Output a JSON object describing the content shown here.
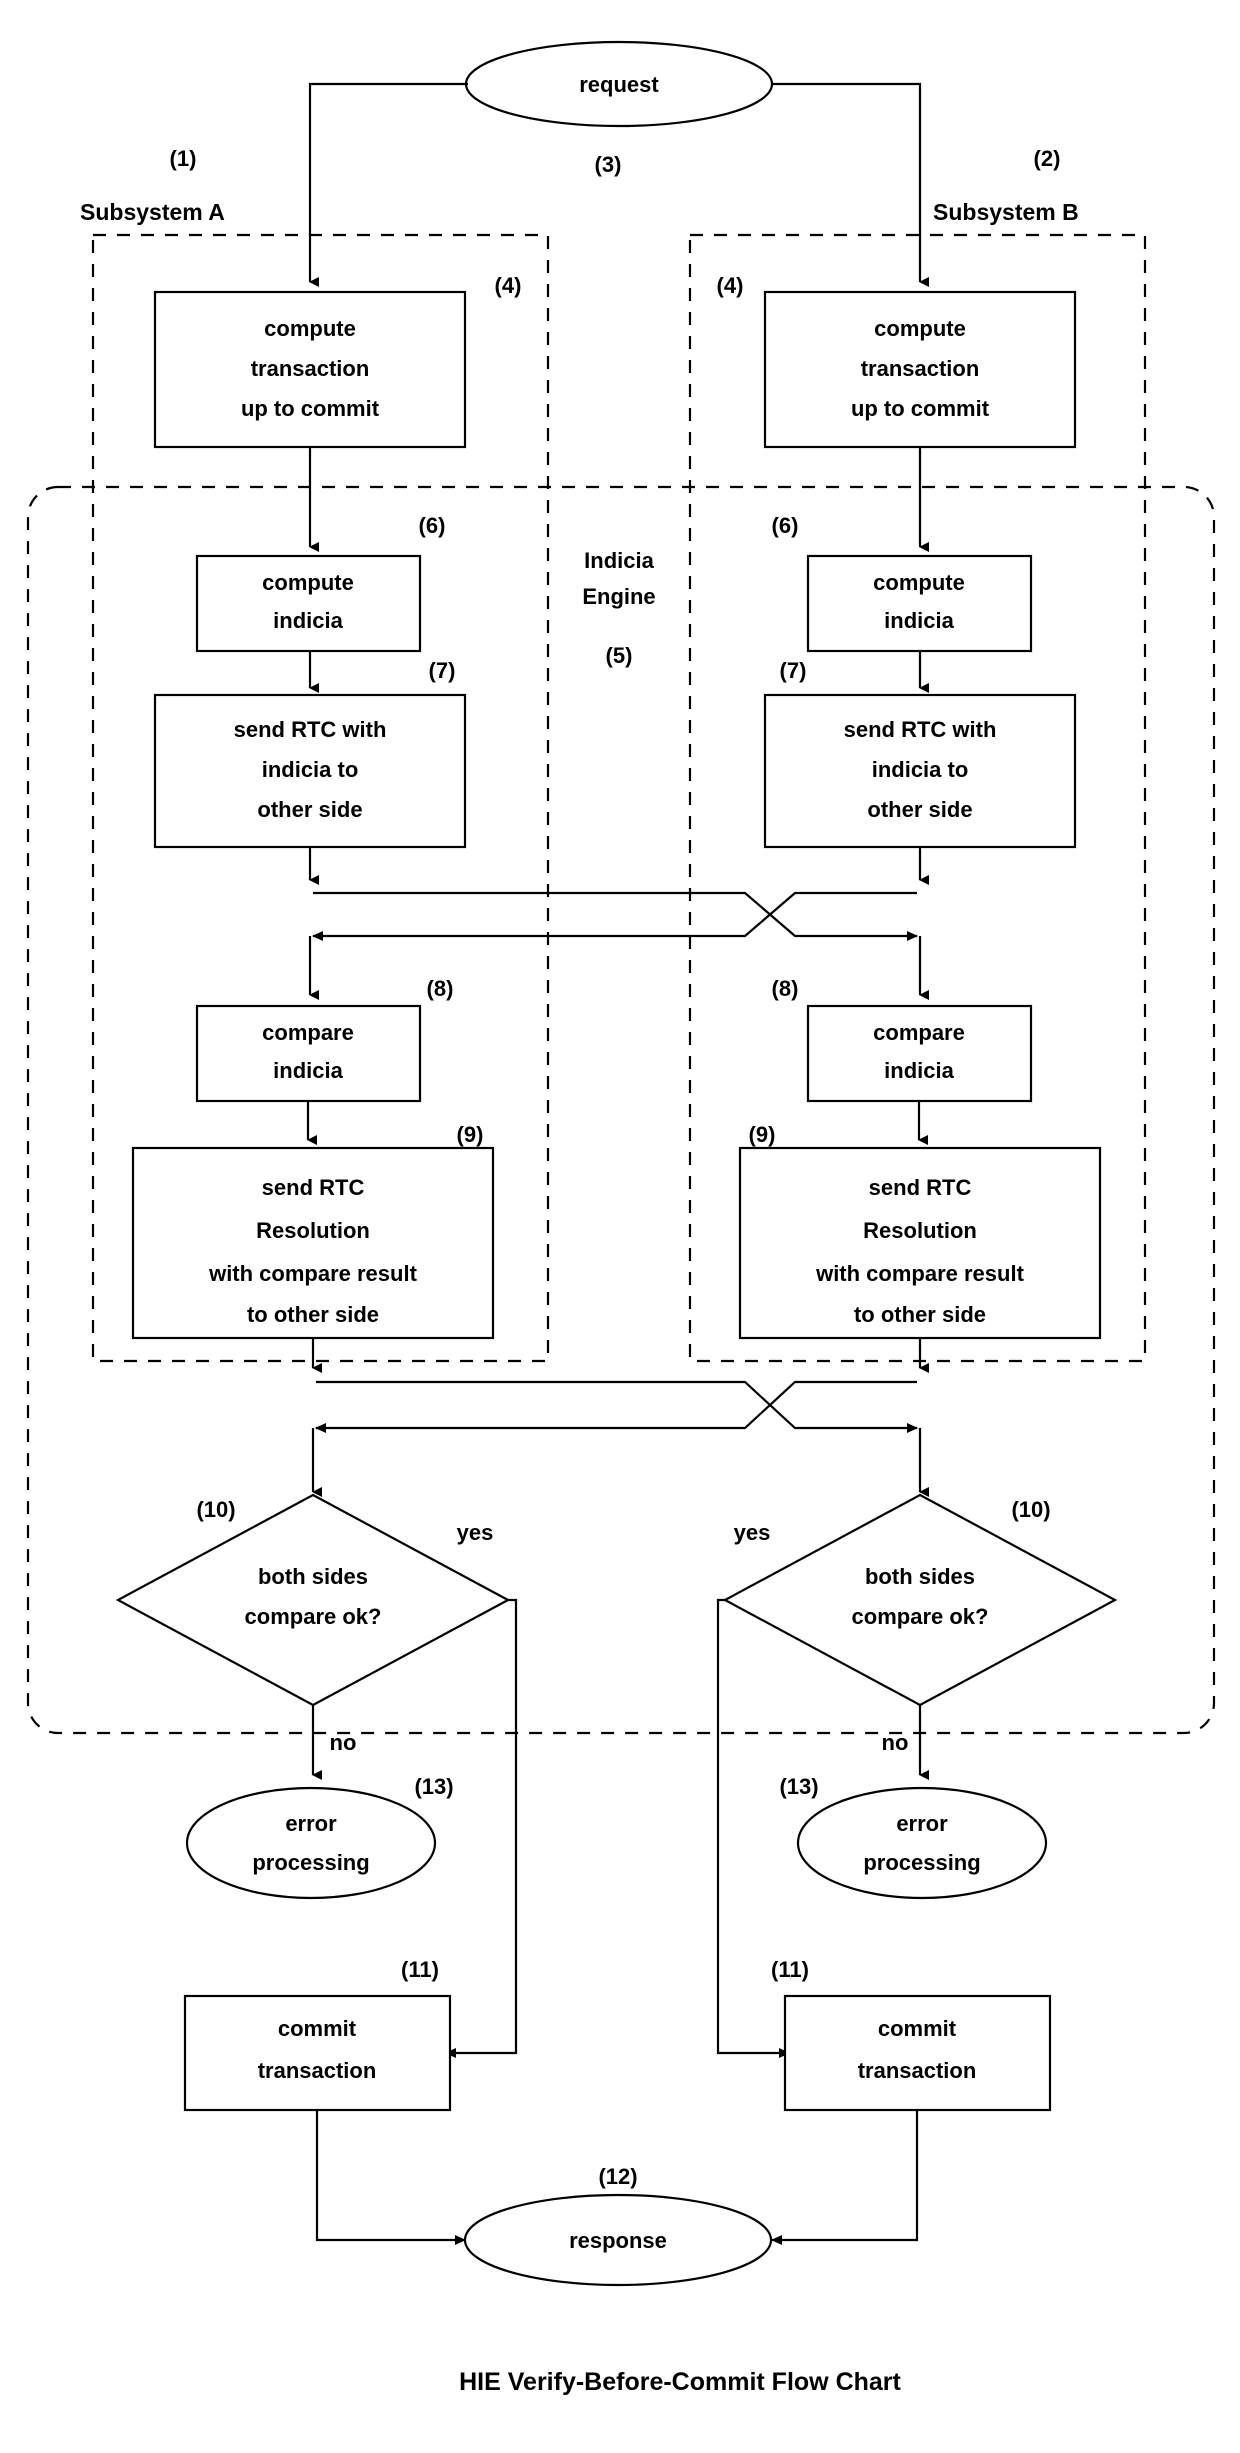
{
  "title": "HIE Verify-Before-Commit Flow Chart",
  "regions": {
    "subsystem_a": {
      "label": "Subsystem A",
      "ref": "(1)"
    },
    "subsystem_b": {
      "label": "Subsystem B",
      "ref": "(2)"
    },
    "indicia_engine": {
      "label_line1": "Indicia",
      "label_line2": "Engine",
      "ref": "(5)"
    }
  },
  "nodes": {
    "request": {
      "label": "request",
      "ref": "(3)",
      "shape": "ellipse"
    },
    "response": {
      "label": "response",
      "ref": "(12)",
      "shape": "ellipse"
    },
    "compute_txn_a": {
      "line1": "compute",
      "line2": "transaction",
      "line3": "up to commit",
      "ref": "(4)",
      "shape": "process"
    },
    "compute_txn_b": {
      "line1": "compute",
      "line2": "transaction",
      "line3": "up to commit",
      "ref": "(4)",
      "shape": "process"
    },
    "compute_indicia_a": {
      "line1": "compute",
      "line2": "indicia",
      "ref": "(6)",
      "shape": "process"
    },
    "compute_indicia_b": {
      "line1": "compute",
      "line2": "indicia",
      "ref": "(6)",
      "shape": "process"
    },
    "send_rtc_a": {
      "line1": "send RTC with",
      "line2": "indicia to",
      "line3": "other side",
      "ref": "(7)",
      "shape": "process"
    },
    "send_rtc_b": {
      "line1": "send RTC with",
      "line2": "indicia to",
      "line3": "other side",
      "ref": "(7)",
      "shape": "process"
    },
    "compare_indicia_a": {
      "line1": "compare",
      "line2": "indicia",
      "ref": "(8)",
      "shape": "process"
    },
    "compare_indicia_b": {
      "line1": "compare",
      "line2": "indicia",
      "ref": "(8)",
      "shape": "process"
    },
    "send_rtc_res_a": {
      "line1": "send RTC",
      "line2": "Resolution",
      "line3": "with compare result",
      "line4": "to other side",
      "ref": "(9)",
      "shape": "process"
    },
    "send_rtc_res_b": {
      "line1": "send RTC",
      "line2": "Resolution",
      "line3": "with compare result",
      "line4": "to other side",
      "ref": "(9)",
      "shape": "process"
    },
    "decision_a": {
      "line1": "both sides",
      "line2": "compare ok?",
      "ref": "(10)",
      "shape": "decision",
      "yes_label": "yes",
      "no_label": "no"
    },
    "decision_b": {
      "line1": "both sides",
      "line2": "compare ok?",
      "ref": "(10)",
      "shape": "decision",
      "yes_label": "yes",
      "no_label": "no"
    },
    "error_a": {
      "line1": "error",
      "line2": "processing",
      "ref": "(13)",
      "shape": "ellipse"
    },
    "error_b": {
      "line1": "error",
      "line2": "processing",
      "ref": "(13)",
      "shape": "ellipse"
    },
    "commit_a": {
      "line1": "commit",
      "line2": "transaction",
      "ref": "(11)",
      "shape": "process"
    },
    "commit_b": {
      "line1": "commit",
      "line2": "transaction",
      "ref": "(11)",
      "shape": "process"
    }
  },
  "colors": {
    "stroke": "#000000",
    "fill": "#ffffff",
    "text": "#000000"
  }
}
